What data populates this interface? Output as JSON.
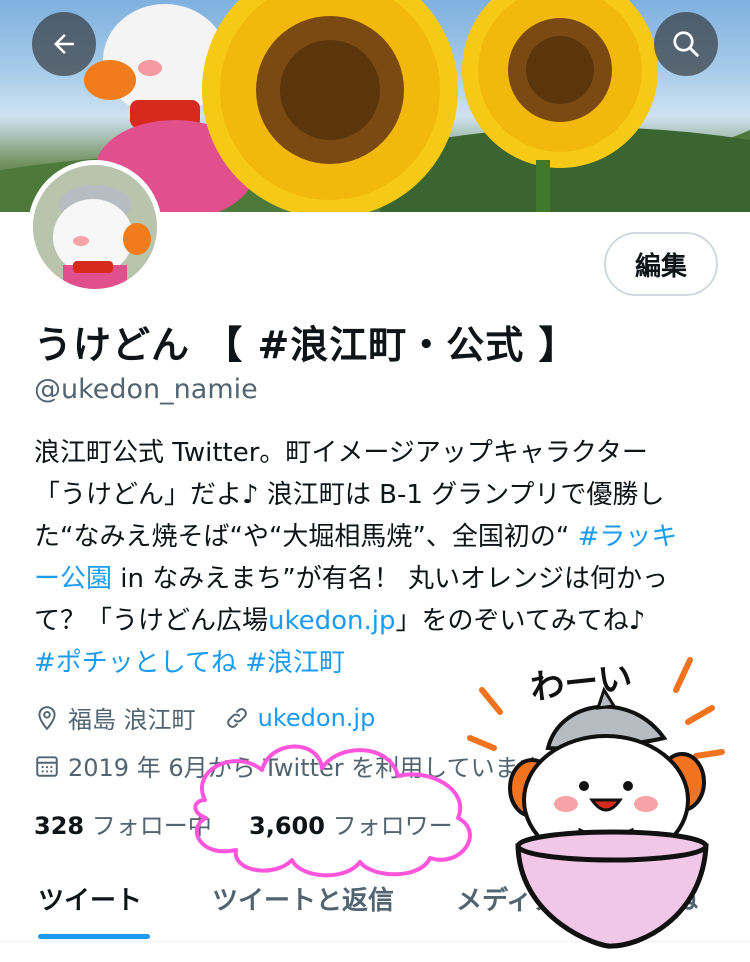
{
  "header": {
    "back_icon": "arrow-left-icon",
    "search_icon": "search-icon"
  },
  "profile": {
    "edit_label": "編集",
    "name": "うけどん 【 #浪江町・公式 】",
    "handle": "@ukedon_namie",
    "bio": {
      "line1": "浪江町公式 Twitter。町イメージアップキャラクター",
      "line2": "「うけどん」だよ♪ 浪江町は B-1 グランプリで優勝し",
      "line3_a": "た“なみえ焼そば“や“大堀相馬焼”、全国初の“ ",
      "hashtag1_a": "#ラッキ",
      "hashtag1_b": "ー公園",
      "line4_a": " in なみえまち”が有名！ 丸いオレンジは何かっ",
      "line5_a": "て？「うけどん広場",
      "bio_link": "ukedon.jp",
      "line5_b": "」をのぞいてみてね♪",
      "hashtag2": "#ポチッとしてね",
      "hashtag3": "#浪江町"
    },
    "location": "福島 浪江町",
    "website": "ukedon.jp",
    "joined": "2019 年 6月から Twitter を利用しています",
    "following_count": "328",
    "following_label": "フォロー中",
    "followers_count": "3,600",
    "followers_label": "フォロワー"
  },
  "tabs": [
    {
      "label": "ツイート",
      "active": true
    },
    {
      "label": "ツイートと返信",
      "active": false
    },
    {
      "label": "メディア",
      "active": false
    },
    {
      "label": "いいね",
      "active": false
    }
  ],
  "sticker": {
    "text": "わーい"
  },
  "colors": {
    "link": "#1d9bf0",
    "secondary_text": "#536471",
    "highlight_marker": "#ff55dd"
  }
}
